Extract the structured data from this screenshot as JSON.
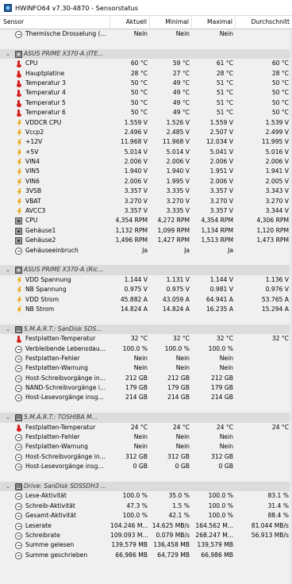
{
  "window": {
    "title": "HWiNFO64 v7.30-4870 - Sensorstatus"
  },
  "columns": [
    "Sensor",
    "Aktuell",
    "Minimal",
    "Maximal",
    "Durchschnitt"
  ],
  "rows": [
    {
      "type": "item",
      "icon": "clock",
      "name": "Thermische Drosselung (...",
      "v": [
        "Nein",
        "Nein",
        "Nein",
        ""
      ]
    },
    {
      "type": "blank"
    },
    {
      "type": "section",
      "icon": "chip",
      "name": "ASUS PRIME X370-A (ITE...",
      "v": [
        "",
        "",
        "",
        ""
      ]
    },
    {
      "type": "item",
      "icon": "therm",
      "name": "CPU",
      "v": [
        "60 °C",
        "59 °C",
        "61 °C",
        "60 °C"
      ]
    },
    {
      "type": "item",
      "icon": "therm",
      "name": "Hauptplatine",
      "v": [
        "28 °C",
        "27 °C",
        "28 °C",
        "28 °C"
      ]
    },
    {
      "type": "item",
      "icon": "therm",
      "name": "Temperatur 3",
      "v": [
        "50 °C",
        "49 °C",
        "51 °C",
        "50 °C"
      ]
    },
    {
      "type": "item",
      "icon": "therm",
      "name": "Temperatur 4",
      "v": [
        "50 °C",
        "49 °C",
        "51 °C",
        "50 °C"
      ]
    },
    {
      "type": "item",
      "icon": "therm",
      "name": "Temperatur 5",
      "v": [
        "50 °C",
        "49 °C",
        "51 °C",
        "50 °C"
      ]
    },
    {
      "type": "item",
      "icon": "therm",
      "name": "Temperatur 6",
      "v": [
        "50 °C",
        "49 °C",
        "51 °C",
        "50 °C"
      ]
    },
    {
      "type": "item",
      "icon": "bolt",
      "name": "VDDCR CPU",
      "v": [
        "1.559 V",
        "1.526 V",
        "1.559 V",
        "1.539 V"
      ]
    },
    {
      "type": "item",
      "icon": "bolt",
      "name": "Vccp2",
      "v": [
        "2.496 V",
        "2.485 V",
        "2.507 V",
        "2.499 V"
      ]
    },
    {
      "type": "item",
      "icon": "bolt",
      "name": "+12V",
      "v": [
        "11.968 V",
        "11.968 V",
        "12.034 V",
        "11.995 V"
      ]
    },
    {
      "type": "item",
      "icon": "bolt",
      "name": "+5V",
      "v": [
        "5.014 V",
        "5.014 V",
        "5.041 V",
        "5.016 V"
      ]
    },
    {
      "type": "item",
      "icon": "bolt",
      "name": "VIN4",
      "v": [
        "2.006 V",
        "2.006 V",
        "2.006 V",
        "2.006 V"
      ]
    },
    {
      "type": "item",
      "icon": "bolt",
      "name": "VIN5",
      "v": [
        "1.940 V",
        "1.940 V",
        "1.951 V",
        "1.941 V"
      ]
    },
    {
      "type": "item",
      "icon": "bolt",
      "name": "VIN6",
      "v": [
        "2.006 V",
        "1.995 V",
        "2.006 V",
        "2.005 V"
      ]
    },
    {
      "type": "item",
      "icon": "bolt",
      "name": "3VSB",
      "v": [
        "3.357 V",
        "3.335 V",
        "3.357 V",
        "3.343 V"
      ]
    },
    {
      "type": "item",
      "icon": "bolt",
      "name": "VBAT",
      "v": [
        "3.270 V",
        "3.270 V",
        "3.270 V",
        "3.270 V"
      ]
    },
    {
      "type": "item",
      "icon": "bolt",
      "name": "AVCC3",
      "v": [
        "3.357 V",
        "3.335 V",
        "3.357 V",
        "3.344 V"
      ]
    },
    {
      "type": "item",
      "icon": "fan",
      "name": "CPU",
      "v": [
        "4,354 RPM",
        "4,272 RPM",
        "4,354 RPM",
        "4,306 RPM"
      ]
    },
    {
      "type": "item",
      "icon": "fan",
      "name": "Gehäuse1",
      "v": [
        "1,132 RPM",
        "1,099 RPM",
        "1,134 RPM",
        "1,120 RPM"
      ]
    },
    {
      "type": "item",
      "icon": "fan",
      "name": "Gehäuse2",
      "v": [
        "1,496 RPM",
        "1,427 RPM",
        "1,513 RPM",
        "1,473 RPM"
      ]
    },
    {
      "type": "item",
      "icon": "clock",
      "name": "Gehäuseeinbruch",
      "v": [
        "Ja",
        "Ja",
        "Ja",
        ""
      ]
    },
    {
      "type": "blank"
    },
    {
      "type": "section",
      "icon": "chip",
      "name": "ASUS PRIME X370-A (Ric...",
      "v": [
        "",
        "",
        "",
        ""
      ]
    },
    {
      "type": "item",
      "icon": "bolt",
      "name": "VDD Spannung",
      "v": [
        "1.144 V",
        "1.131 V",
        "1.144 V",
        "1.136 V"
      ]
    },
    {
      "type": "item",
      "icon": "bolt",
      "name": "NB Spannung",
      "v": [
        "0.975 V",
        "0.975 V",
        "0.981 V",
        "0.976 V"
      ]
    },
    {
      "type": "item",
      "icon": "bolt",
      "name": "VDD Strom",
      "v": [
        "45.882 A",
        "43.059 A",
        "64.941 A",
        "53.765 A"
      ]
    },
    {
      "type": "item",
      "icon": "bolt",
      "name": "NB Strom",
      "v": [
        "14.824 A",
        "14.824 A",
        "16.235 A",
        "15.294 A"
      ]
    },
    {
      "type": "blank"
    },
    {
      "type": "section",
      "icon": "disk",
      "name": "S.M.A.R.T.: SanDisk SDS...",
      "v": [
        "",
        "",
        "",
        ""
      ]
    },
    {
      "type": "item",
      "icon": "therm",
      "name": "Festplatten-Temperatur",
      "v": [
        "32 °C",
        "32 °C",
        "32 °C",
        "32 °C"
      ]
    },
    {
      "type": "item",
      "icon": "clock",
      "name": "Verbleibende Lebensdau...",
      "v": [
        "100.0 %",
        "100.0 %",
        "100.0 %",
        ""
      ]
    },
    {
      "type": "item",
      "icon": "clock",
      "name": "Festplatten-Fehler",
      "v": [
        "Nein",
        "Nein",
        "Nein",
        ""
      ]
    },
    {
      "type": "item",
      "icon": "clock",
      "name": "Festplatten-Warnung",
      "v": [
        "Nein",
        "Nein",
        "Nein",
        ""
      ]
    },
    {
      "type": "item",
      "icon": "clock",
      "name": "Host-Schreibvorgänge in...",
      "v": [
        "212 GB",
        "212 GB",
        "212 GB",
        ""
      ]
    },
    {
      "type": "item",
      "icon": "clock",
      "name": "NAND-Schreibvorgänge i...",
      "v": [
        "179 GB",
        "179 GB",
        "179 GB",
        ""
      ]
    },
    {
      "type": "item",
      "icon": "clock",
      "name": "Host-Lesevorgänge insg...",
      "v": [
        "214 GB",
        "214 GB",
        "214 GB",
        ""
      ]
    },
    {
      "type": "blank"
    },
    {
      "type": "section",
      "icon": "disk",
      "name": "S.M.A.R.T.: TOSHIBA M...",
      "v": [
        "",
        "",
        "",
        ""
      ]
    },
    {
      "type": "item",
      "icon": "therm",
      "name": "Festplatten-Temperatur",
      "v": [
        "24 °C",
        "24 °C",
        "24 °C",
        "24 °C"
      ]
    },
    {
      "type": "item",
      "icon": "clock",
      "name": "Festplatten-Fehler",
      "v": [
        "Nein",
        "Nein",
        "Nein",
        ""
      ]
    },
    {
      "type": "item",
      "icon": "clock",
      "name": "Festplatten-Warnung",
      "v": [
        "Nein",
        "Nein",
        "Nein",
        ""
      ]
    },
    {
      "type": "item",
      "icon": "clock",
      "name": "Host-Schreibvorgänge in...",
      "v": [
        "312 GB",
        "312 GB",
        "312 GB",
        ""
      ]
    },
    {
      "type": "item",
      "icon": "clock",
      "name": "Host-Lesevorgänge insg...",
      "v": [
        "0 GB",
        "0 GB",
        "0 GB",
        ""
      ]
    },
    {
      "type": "blank"
    },
    {
      "type": "section",
      "icon": "disk",
      "name": "Drive: SanDisk SDSSDH3 ...",
      "v": [
        "",
        "",
        "",
        ""
      ]
    },
    {
      "type": "item",
      "icon": "clock",
      "name": "Lese-Aktivität",
      "v": [
        "100.0 %",
        "35.0 %",
        "100.0 %",
        "83.1 %"
      ]
    },
    {
      "type": "item",
      "icon": "clock",
      "name": "Schreib-Aktivität",
      "v": [
        "47.3 %",
        "1.5 %",
        "100.0 %",
        "31.4 %"
      ]
    },
    {
      "type": "item",
      "icon": "clock",
      "name": "Gesamt-Aktivität",
      "v": [
        "100.0 %",
        "42.1 %",
        "100.0 %",
        "88.4 %"
      ]
    },
    {
      "type": "item",
      "icon": "clock",
      "name": "Leserate",
      "v": [
        "104.246 M...",
        "14.625 MB/s",
        "164.562 M...",
        "81.044 MB/s"
      ]
    },
    {
      "type": "item",
      "icon": "clock",
      "name": "Schreibrate",
      "v": [
        "109.093 M...",
        "0.079 MB/s",
        "268.247 M...",
        "56.913 MB/s"
      ]
    },
    {
      "type": "item",
      "icon": "clock",
      "name": "Summe gelesen",
      "v": [
        "139,579 MB",
        "136,458 MB",
        "139,579 MB",
        ""
      ]
    },
    {
      "type": "item",
      "icon": "clock",
      "name": "Summe geschrieben",
      "v": [
        "66,986 MB",
        "64,729 MB",
        "66,986 MB",
        ""
      ]
    }
  ],
  "section_expander": "⌄"
}
